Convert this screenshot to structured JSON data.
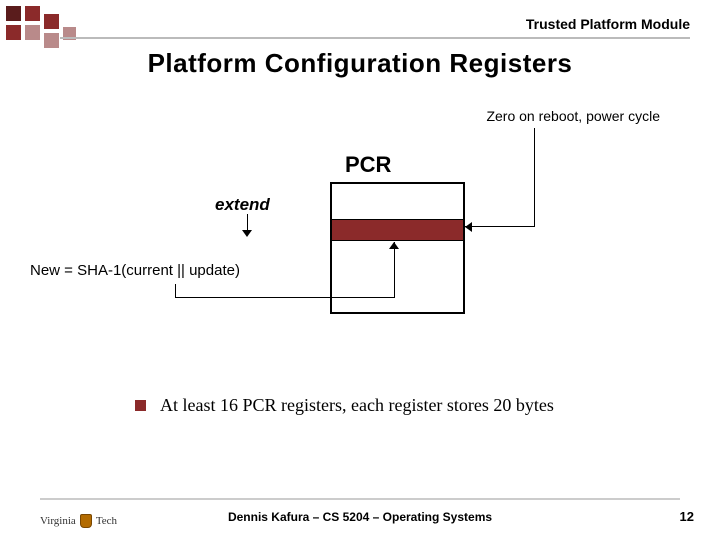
{
  "header": {
    "context": "Trusted Platform Module"
  },
  "title": "Platform Configuration Registers",
  "annotations": {
    "zero": "Zero on reboot, power cycle",
    "pcr": "PCR",
    "extend": "extend",
    "formula": "New = SHA-1(current || update)"
  },
  "bullets": [
    "At least 16 PCR registers, each register stores 20 bytes"
  ],
  "footer": {
    "text": "Dennis Kafura – CS 5204 – Operating Systems",
    "page": "12",
    "logo_institution": "Virginia",
    "logo_institution2": "Tech"
  },
  "colors": {
    "accent": "#8b2a2a"
  }
}
